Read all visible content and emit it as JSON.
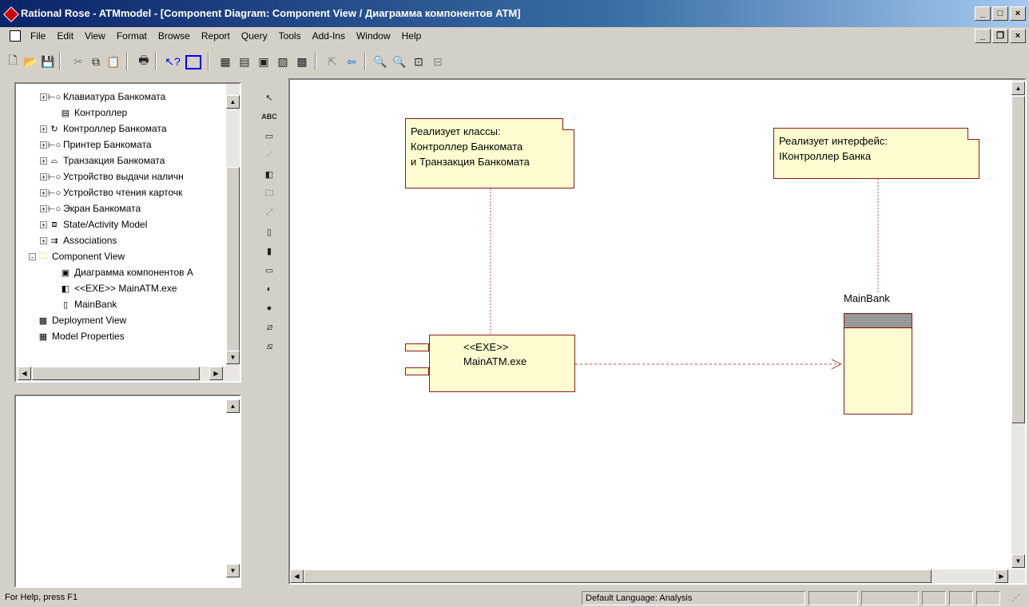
{
  "window": {
    "title": "Rational Rose - ATMmodel - [Component Diagram: Component View / Диаграмма компонентов ATM]"
  },
  "menu": [
    "File",
    "Edit",
    "View",
    "Format",
    "Browse",
    "Report",
    "Query",
    "Tools",
    "Add-Ins",
    "Window",
    "Help"
  ],
  "browser": {
    "items": [
      {
        "label": "Клавиатура Банкомата",
        "icon": "interface-class-icon",
        "indent": 1,
        "expand": "+"
      },
      {
        "label": "Контроллер",
        "icon": "class-icon",
        "indent": 2,
        "expand": ""
      },
      {
        "label": "Контроллер Банкомата",
        "icon": "control-class-icon",
        "indent": 1,
        "expand": "+"
      },
      {
        "label": "Принтер Банкомата",
        "icon": "interface-class-icon",
        "indent": 1,
        "expand": "+"
      },
      {
        "label": "Транзакция Банкомата",
        "icon": "entity-class-icon",
        "indent": 1,
        "expand": "+"
      },
      {
        "label": "Устройство выдачи наличн",
        "icon": "interface-class-icon",
        "indent": 1,
        "expand": "+"
      },
      {
        "label": "Устройство чтения карточк",
        "icon": "interface-class-icon",
        "indent": 1,
        "expand": "+"
      },
      {
        "label": "Экран Банкомата",
        "icon": "interface-class-icon",
        "indent": 1,
        "expand": "+"
      },
      {
        "label": "State/Activity Model",
        "icon": "state-model-icon",
        "indent": 1,
        "expand": "+"
      },
      {
        "label": "Associations",
        "icon": "associations-icon",
        "indent": 1,
        "expand": "+"
      },
      {
        "label": "Component View",
        "icon": "folder-icon",
        "indent": 0,
        "expand": "-"
      },
      {
        "label": "Диаграмма компонентов А",
        "icon": "component-diagram-icon",
        "indent": 2,
        "expand": ""
      },
      {
        "label": "<<EXE>> MainATM.exe",
        "icon": "exe-component-icon",
        "indent": 2,
        "expand": ""
      },
      {
        "label": "MainBank",
        "icon": "component-icon",
        "indent": 2,
        "expand": ""
      },
      {
        "label": "Deployment View",
        "icon": "deployment-view-icon",
        "indent": 0,
        "expand": ""
      },
      {
        "label": "Model Properties",
        "icon": "model-properties-icon",
        "indent": 0,
        "expand": ""
      }
    ]
  },
  "diagram": {
    "note1": [
      "Реализует классы:",
      "Контроллер Банкомата",
      "и Транзакция Банкомата"
    ],
    "note2": [
      "Реализует интерфейс:",
      "IКонтроллер Банка"
    ],
    "component_main": {
      "stereotype": "<<EXE>>",
      "name": "MainATM.exe"
    },
    "component_bank": {
      "name": "MainBank"
    },
    "line_color": "#8b1a1a",
    "fill_color": "#fffdd0"
  },
  "status": {
    "help": "For Help, press F1",
    "language": "Default Language: Analysis"
  }
}
